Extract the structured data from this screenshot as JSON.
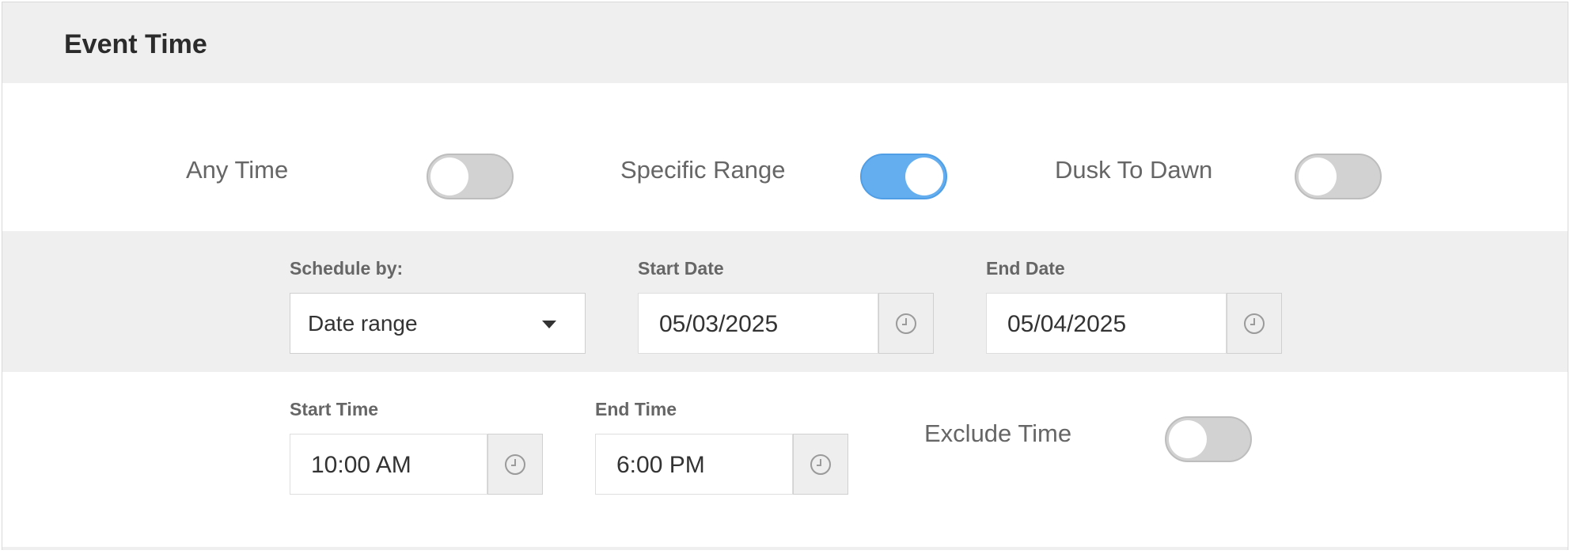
{
  "header": {
    "title": "Event Time"
  },
  "toggles": {
    "any_time": {
      "label": "Any Time",
      "on": false
    },
    "specific_range": {
      "label": "Specific Range",
      "on": true
    },
    "dusk_to_dawn": {
      "label": "Dusk To Dawn",
      "on": false
    },
    "exclude_time": {
      "label": "Exclude Time",
      "on": false
    }
  },
  "schedule_by": {
    "label": "Schedule by:",
    "value": "Date range"
  },
  "start_date": {
    "label": "Start Date",
    "value": "05/03/2025",
    "icon": "clock-icon"
  },
  "end_date": {
    "label": "End Date",
    "value": "05/04/2025",
    "icon": "clock-icon"
  },
  "start_time": {
    "label": "Start Time",
    "value": "10:00 AM",
    "icon": "clock-icon"
  },
  "end_time": {
    "label": "End Time",
    "value": "6:00 PM",
    "icon": "clock-icon"
  },
  "colors": {
    "toggle_on": "#64aef0",
    "toggle_off": "#d2d2d2",
    "band": "#efefef"
  }
}
